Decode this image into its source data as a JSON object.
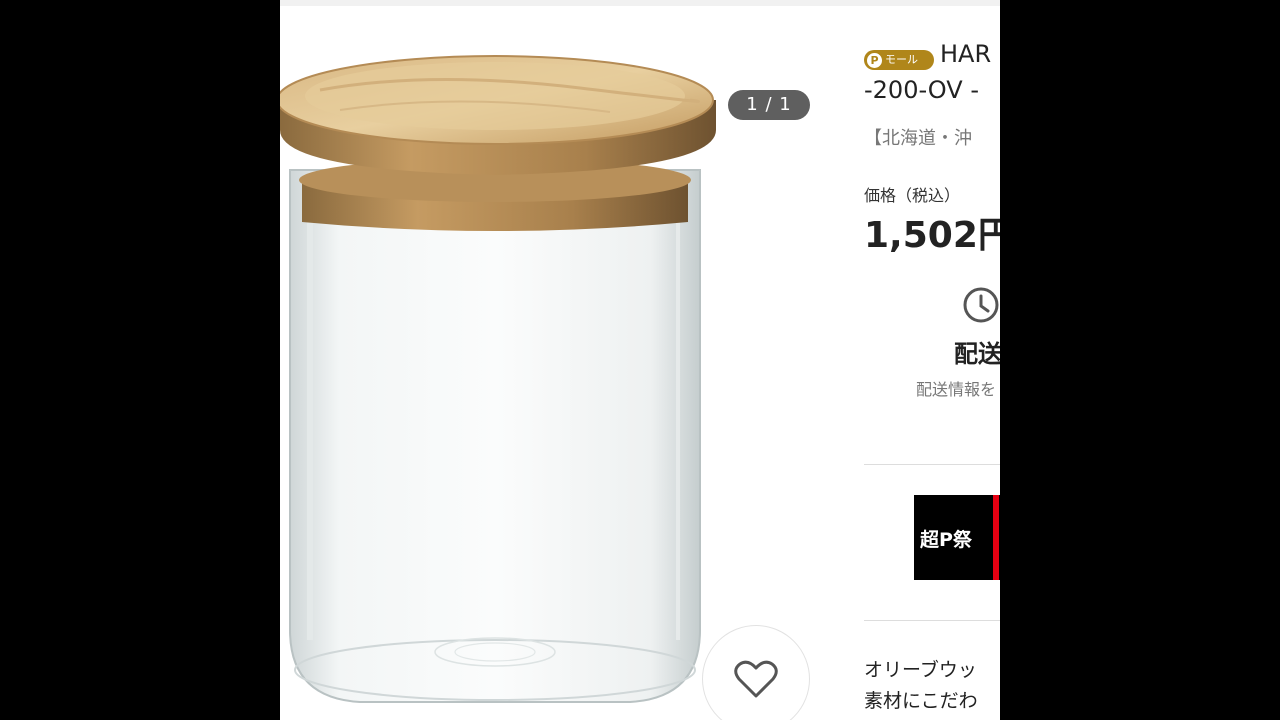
{
  "gallery": {
    "counter": "1 / 1",
    "image_alt": "glass canister with olive wood lid",
    "favorite_icon": "heart-icon"
  },
  "product": {
    "badge_label": "モール",
    "badge_icon": "p-logo-icon",
    "title_line1": "HAR",
    "title_line2": "-200-OV -",
    "shipping_region": "【北海道・沖",
    "price_label": "価格（税込）",
    "price": "1,502円"
  },
  "delivery": {
    "icon": "clock-icon",
    "title": "配送",
    "subtitle": "配送情報を"
  },
  "banner": {
    "text": "超P祭"
  },
  "description": {
    "line1": "オリーブウッ",
    "line2": "素材にこだわ"
  },
  "colors": {
    "badge": "#b0861a",
    "counter_bg": "#5f5f5f",
    "banner_bg": "#000000",
    "banner_accent": "#e60012"
  }
}
